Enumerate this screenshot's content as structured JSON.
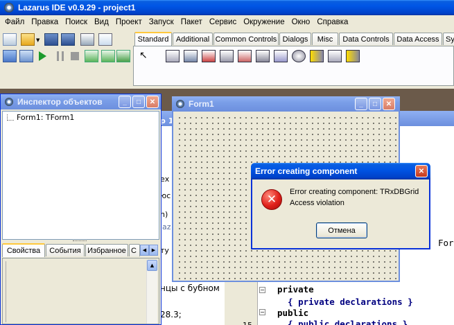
{
  "main_window": {
    "title": "Lazarus IDE v0.9.29 - project1",
    "menu": [
      "Файл",
      "Правка",
      "Поиск",
      "Вид",
      "Проект",
      "Запуск",
      "Пакет",
      "Сервис",
      "Окружение",
      "Окно",
      "Справка"
    ],
    "palette_tabs": [
      "Standard",
      "Additional",
      "Common Controls",
      "Dialogs",
      "Misc",
      "Data Controls",
      "Data Access",
      "Sy"
    ],
    "selected_tab": "Standard"
  },
  "inspector": {
    "title": "Инспектор объектов",
    "tree_item": "Form1: TForm1",
    "tabs": [
      "Свойства",
      "События",
      "Избранное",
      "С"
    ]
  },
  "form1": {
    "title": "Form1"
  },
  "background_editor": {
    "fragments": [
      "р 1",
      "ех",
      "юс",
      "n)",
      "laz",
      "ту",
      "For",
      "нцы с бубном",
      "28.3;",
      "15"
    ],
    "code_lines": [
      "private",
      "  { private declarations }",
      "public",
      "  { public declarations }"
    ]
  },
  "dialog": {
    "title": "Error creating component",
    "message_line1": "Error creating component: TRxDBGrid",
    "message_line2": "Access violation",
    "button": "Отмена"
  },
  "colors": {
    "xp_title_blue": "#0055e5",
    "close_red": "#c5391d",
    "error_red": "#e0201b"
  }
}
